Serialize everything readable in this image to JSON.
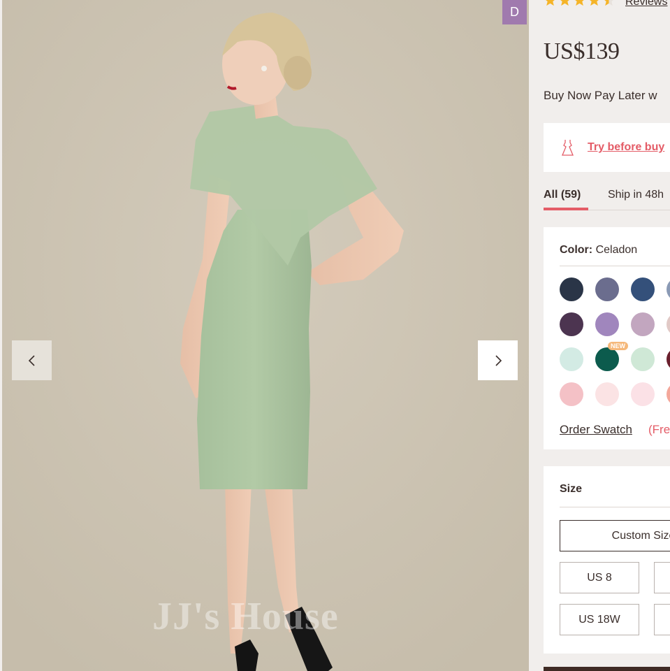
{
  "gallery": {
    "watermark": "JJ's House",
    "prev_icon": "chevron-left-icon",
    "next_icon": "chevron-right-icon",
    "badge": "D"
  },
  "product": {
    "rating_stars": 4.5,
    "reviews_label": "Reviews",
    "price": "US$139",
    "bnpl_text": "Buy Now Pay Later w",
    "try_before_label": "Try before buy",
    "tabs": [
      {
        "label": "All (59)",
        "active": true
      },
      {
        "label": "Ship in 48h",
        "active": false
      }
    ],
    "color": {
      "label": "Color:",
      "value": "Celadon",
      "swatches": [
        [
          "#2a3547",
          "#6b6d8e",
          "#34507a",
          "#8a9ab5"
        ],
        [
          "#4c3450",
          "#a086bd",
          "#c2a6bf",
          "#e1c9c6"
        ],
        [
          "#d3ebe4",
          "#0c5b4d",
          "#cfe8d6",
          "#6a1f2d"
        ],
        [
          "#f4c1c6",
          "#fbe3e4",
          "#fbe1e6",
          "#f4a79a"
        ]
      ],
      "new_tag": "NEW",
      "order_swatch": "Order Swatch",
      "free_label": "(Free"
    },
    "size": {
      "title": "Size",
      "custom_label": "Custom Size",
      "rows": [
        [
          "US 8",
          ""
        ],
        [
          "US 18W",
          ""
        ]
      ]
    }
  },
  "colors": {
    "accent": "#e45c67",
    "text": "#3a2e2b",
    "panel_bg": "#f1eeec",
    "badge_bg": "#a07aae"
  }
}
